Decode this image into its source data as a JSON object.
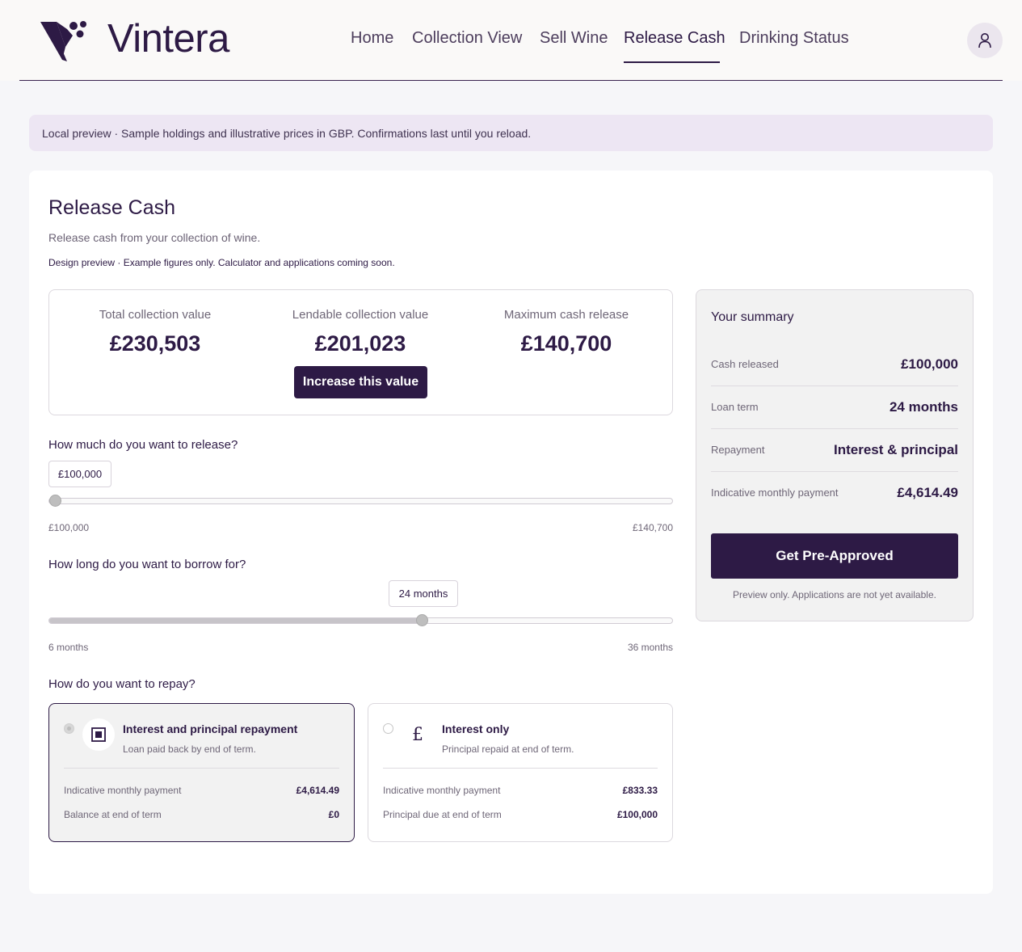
{
  "header": {
    "brand": "Vintera",
    "nav": [
      {
        "label": "Home"
      },
      {
        "label": "Collection View"
      },
      {
        "label": "Sell Wine"
      },
      {
        "label": "Release Cash"
      },
      {
        "label": "Drinking Status"
      }
    ],
    "active_nav": "Release Cash",
    "avatar_icon": "user-icon"
  },
  "notice": "Local preview · Sample holdings and illustrative prices in GBP. Confirmations last until you reload.",
  "page": {
    "title": "Release Cash",
    "subtitle": "Release cash from your collection of wine.",
    "note": "Design preview · Example figures only. Calculator and applications coming soon."
  },
  "stats": [
    {
      "label": "Total collection value",
      "value": "£230,503"
    },
    {
      "label": "Lendable collection value",
      "value": "£201,023"
    },
    {
      "label": "Maximum cash release",
      "value": "£140,700"
    }
  ],
  "increase_button": "Increase this value",
  "release": {
    "question": "How much do you want to release?",
    "value": "£100,000",
    "min_label": "£100,000",
    "max_label": "£140,700",
    "level": 0.0
  },
  "term": {
    "question": "How long do you want to borrow for?",
    "value": "24 months",
    "min_label": "6 months",
    "max_label": "36 months",
    "level": 0.6
  },
  "repay": {
    "question": "How do you want to repay?",
    "options": [
      {
        "title": "Interest and principal repayment",
        "desc": "Loan paid back by end of term.",
        "icon": "square-stop-icon",
        "selected": true,
        "rows": [
          {
            "label": "Indicative monthly payment",
            "value": "£4,614.49"
          },
          {
            "label": "Balance at end of term",
            "value": "£0"
          }
        ]
      },
      {
        "title": "Interest only",
        "desc": "Principal repaid at end of term.",
        "icon": "pound-icon",
        "icon_glyph": "£",
        "selected": false,
        "rows": [
          {
            "label": "Indicative monthly payment",
            "value": "£833.33"
          },
          {
            "label": "Principal due at end of term",
            "value": "£100,000"
          }
        ]
      }
    ]
  },
  "summary": {
    "title": "Your summary",
    "rows": [
      {
        "label": "Cash released",
        "value": "£100,000"
      },
      {
        "label": "Loan term",
        "value": "24 months"
      },
      {
        "label": "Repayment",
        "value": "Interest & principal"
      },
      {
        "label": "Indicative monthly payment",
        "value": "£4,614.49"
      }
    ],
    "button": "Get Pre-Approved",
    "note": "Preview only. Applications are not yet available."
  },
  "colors": {
    "brand": "#2d1a45",
    "notice_bg": "#ede6f3",
    "page_bg": "#f6f6f9"
  }
}
